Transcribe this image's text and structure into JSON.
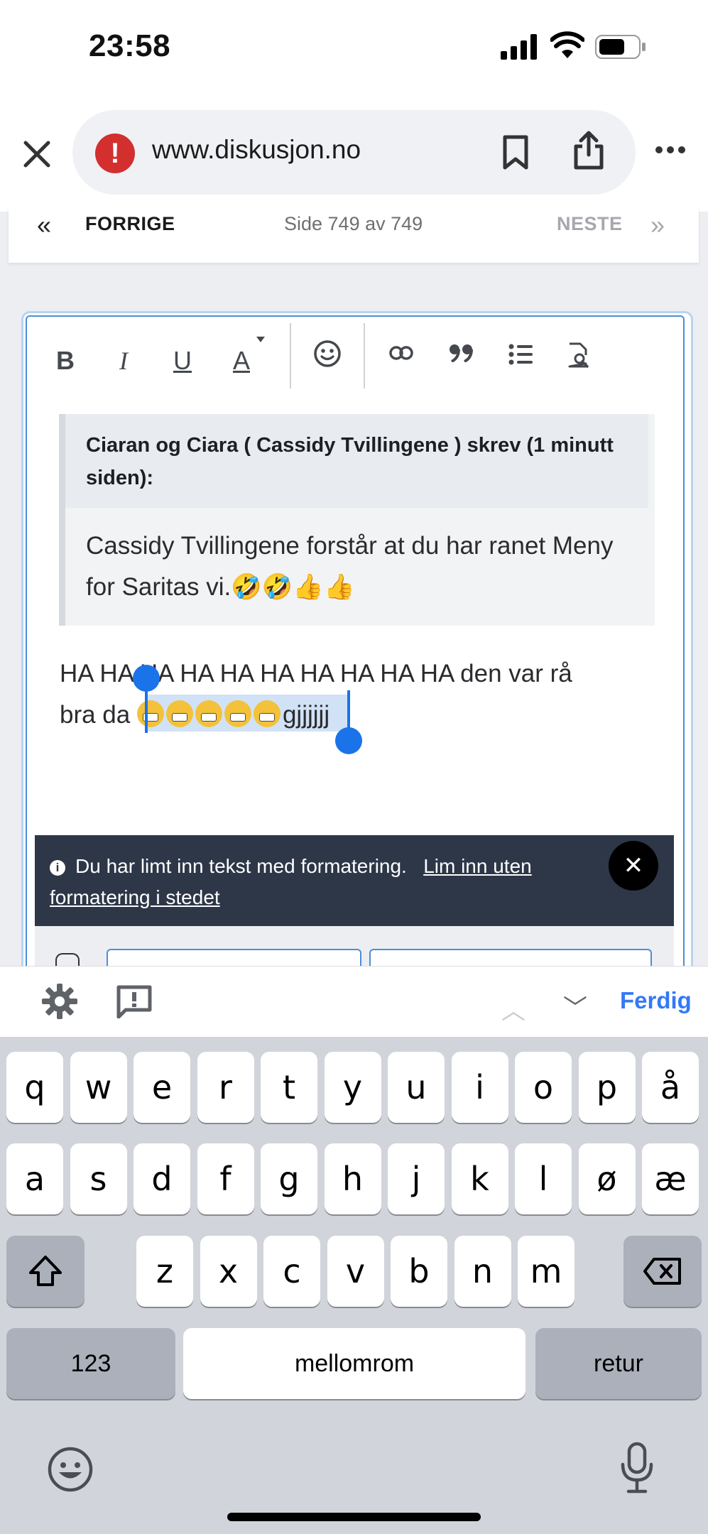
{
  "status_bar": {
    "time": "23:58"
  },
  "browser": {
    "url": "www.diskusjon.no"
  },
  "pagination": {
    "prev_label": "FORRIGE",
    "prev_icon": "«",
    "page_info": "Side 749 av 749",
    "next_label": "NESTE",
    "next_icon": "»"
  },
  "toolbar": {
    "bold": "B",
    "italic": "I",
    "underline": "U",
    "color": "A",
    "emoji_icon": "☺",
    "link_icon": "link-icon",
    "quote": "99",
    "list_icon": "list-icon",
    "preview_icon": "preview-icon"
  },
  "quote": {
    "author": "Ciaran og Ciara ( Cassidy Tvillingene ) skrev (1 minutt siden):",
    "body": "Cassidy Tvillingene forstår at du har ranet Meny for Saritas vi.🤣🤣👍👍"
  },
  "message": {
    "line1": "HA HA HA HA HA HA HA HA HA HA den var rå",
    "line2_prefix": "bra da ",
    "emoji_count": 5,
    "line2_suffix": "gjjjjjj"
  },
  "notice": {
    "text": "Du har limt inn tekst med formatering.",
    "link": "Lim inn uten formatering i stedet"
  },
  "accessory": {
    "done_label": "Ferdig"
  },
  "keyboard": {
    "row1": [
      "q",
      "w",
      "e",
      "r",
      "t",
      "y",
      "u",
      "i",
      "o",
      "p",
      "å"
    ],
    "row2": [
      "a",
      "s",
      "d",
      "f",
      "g",
      "h",
      "j",
      "k",
      "l",
      "ø",
      "æ"
    ],
    "row3": [
      "z",
      "x",
      "c",
      "v",
      "b",
      "n",
      "m"
    ],
    "numbers": "123",
    "space": "mellomrom",
    "return": "retur"
  },
  "colors": {
    "accent": "#1a73e8",
    "link_blue": "#3478f6",
    "notice_bg": "#2d3748",
    "warning_red": "#d32f2f"
  }
}
